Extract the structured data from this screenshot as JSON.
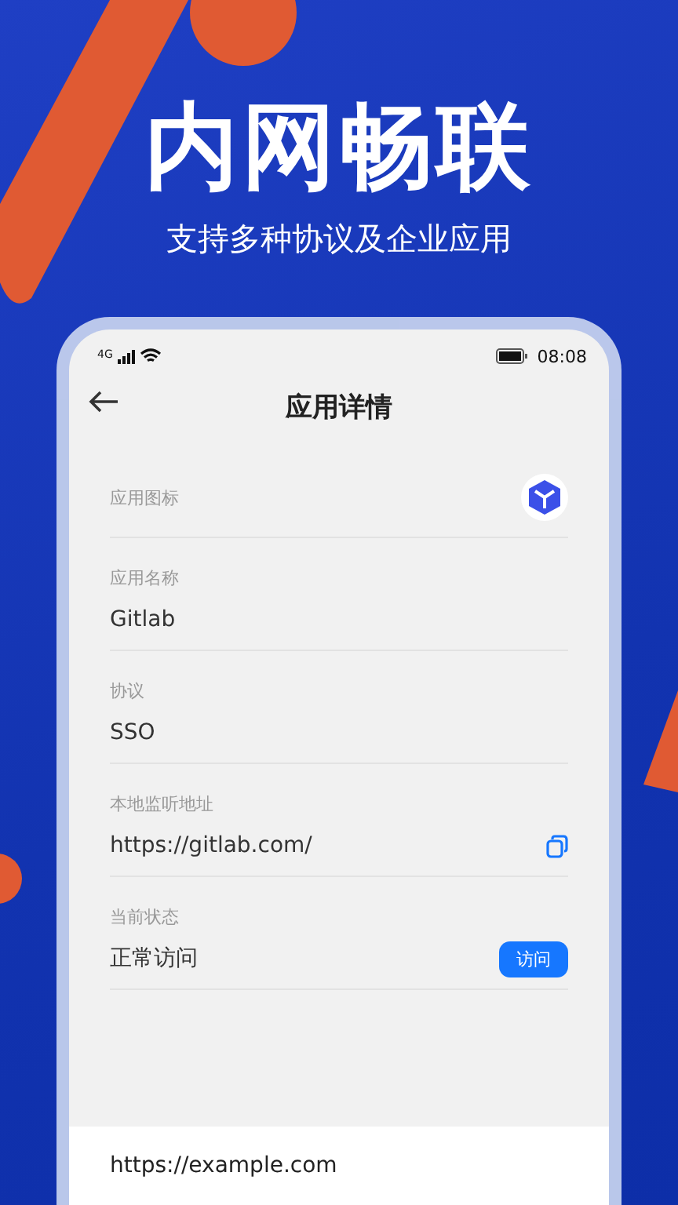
{
  "promo": {
    "title": "内网畅联",
    "subtitle": "支持多种协议及企业应用"
  },
  "status_bar": {
    "network": "4G",
    "time": "08:08"
  },
  "header": {
    "title": "应用详情"
  },
  "fields": [
    {
      "kind": "icon",
      "label": "应用图标"
    },
    {
      "kind": "text",
      "label": "应用名称",
      "value": "Gitlab"
    },
    {
      "kind": "text",
      "label": "协议",
      "value": "SSO"
    },
    {
      "kind": "copy",
      "label": "本地监听地址",
      "value": "https://gitlab.com/"
    },
    {
      "kind": "action",
      "label": "当前状态",
      "value": "正常访问",
      "button": "访问"
    }
  ],
  "bottom_bar": {
    "url": "https://example.com"
  }
}
